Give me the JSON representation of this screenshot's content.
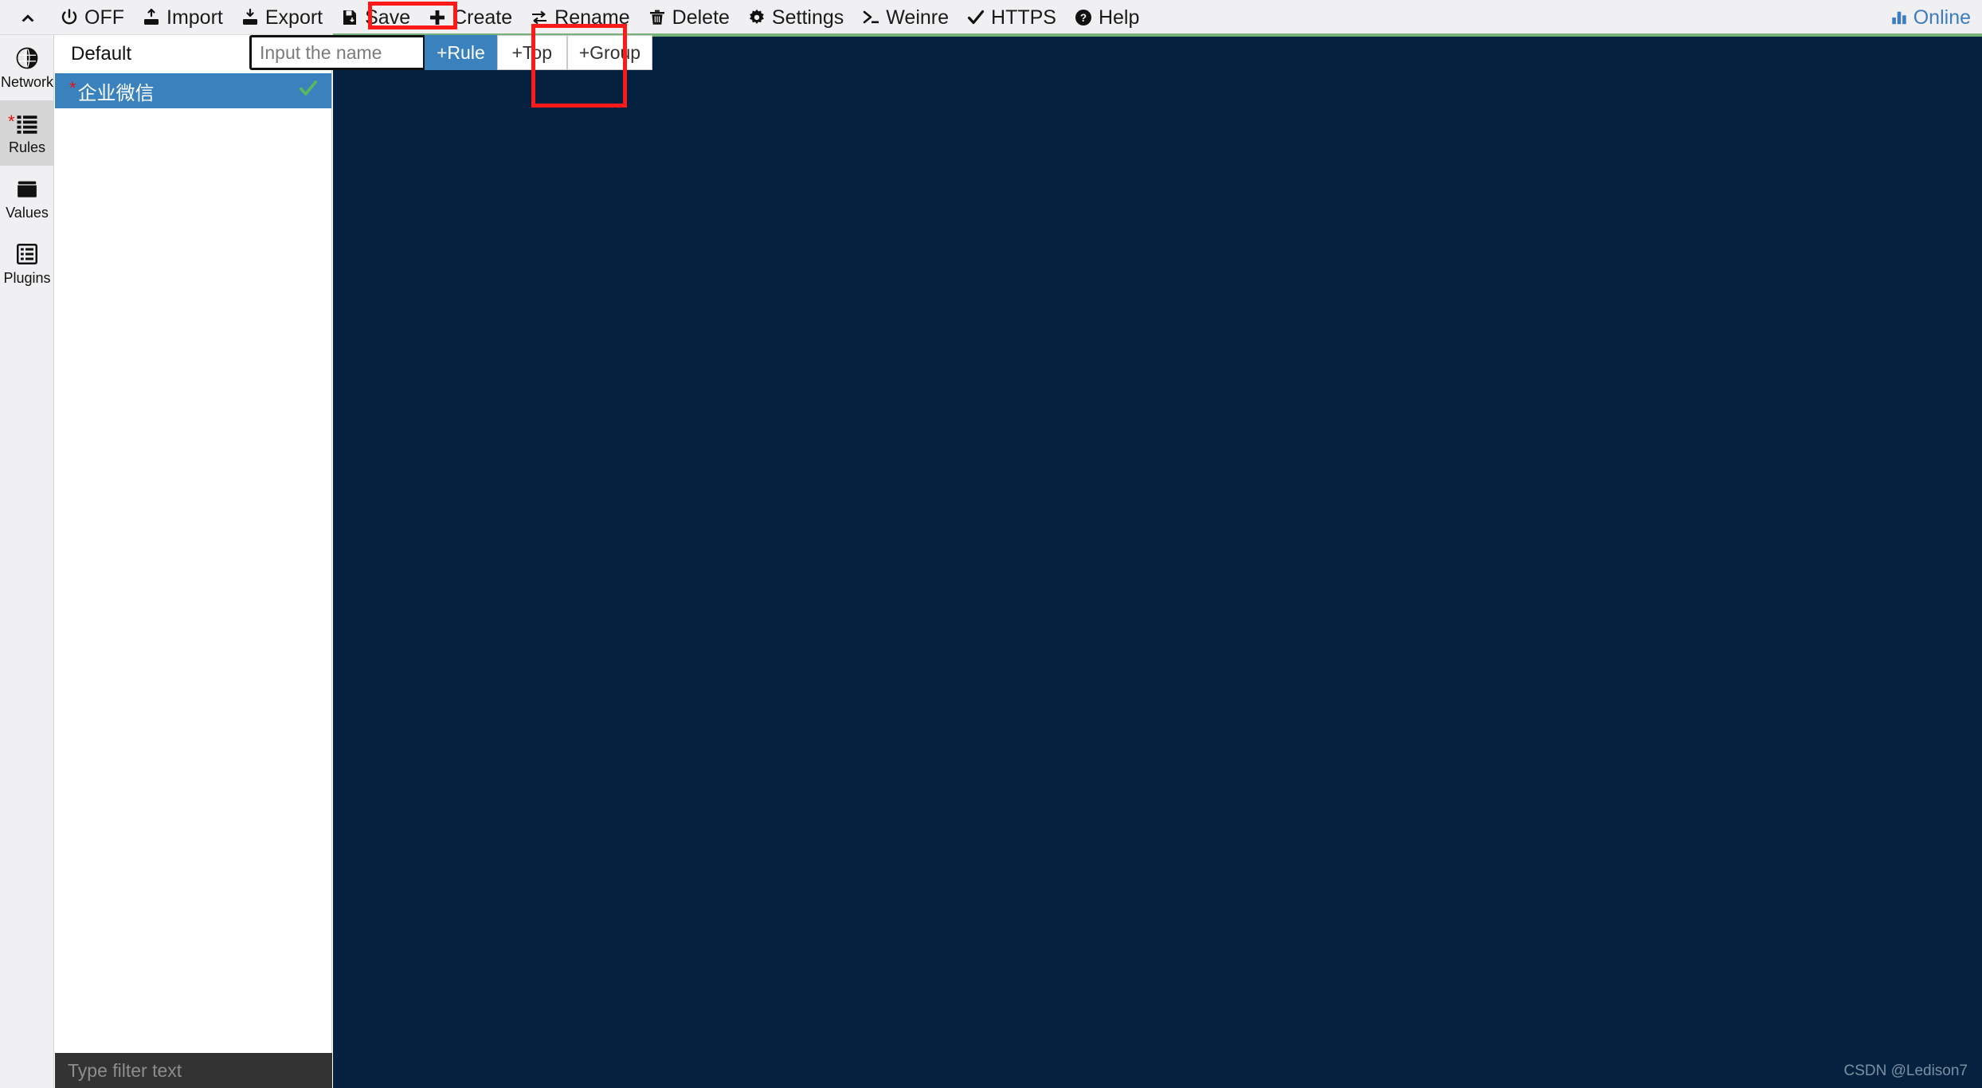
{
  "toolbar": {
    "collapse_icon": "chevron-up-icon",
    "items": [
      {
        "id": "off",
        "label": "OFF",
        "icon": "power-icon"
      },
      {
        "id": "import",
        "label": "Import",
        "icon": "import-icon"
      },
      {
        "id": "export",
        "label": "Export",
        "icon": "export-icon"
      },
      {
        "id": "save",
        "label": "Save",
        "icon": "save-icon"
      },
      {
        "id": "create",
        "label": "Create",
        "icon": "plus-icon"
      },
      {
        "id": "rename",
        "label": "Rename",
        "icon": "rename-icon"
      },
      {
        "id": "delete",
        "label": "Delete",
        "icon": "trash-icon"
      },
      {
        "id": "settings",
        "label": "Settings",
        "icon": "gear-icon"
      },
      {
        "id": "weinre",
        "label": "Weinre",
        "icon": "terminal-icon"
      },
      {
        "id": "https",
        "label": "HTTPS",
        "icon": "check-icon"
      },
      {
        "id": "help",
        "label": "Help",
        "icon": "question-circle-icon"
      }
    ],
    "status": {
      "label": "Online",
      "icon": "bar-chart-icon",
      "color": "#3c7cbf"
    }
  },
  "rail": {
    "items": [
      {
        "id": "network",
        "label": "Network",
        "icon": "globe-icon",
        "active": false,
        "modified": false
      },
      {
        "id": "rules",
        "label": "Rules",
        "icon": "list-icon",
        "active": true,
        "modified": true
      },
      {
        "id": "values",
        "label": "Values",
        "icon": "folder-icon",
        "active": false,
        "modified": false
      },
      {
        "id": "plugins",
        "label": "Plugins",
        "icon": "plugins-icon",
        "active": false,
        "modified": false
      }
    ]
  },
  "list_panel": {
    "header_label": "Default",
    "rows": [
      {
        "name": "企业微信",
        "selected": true,
        "modified": true,
        "enabled": true,
        "check_icon": "check-icon"
      }
    ],
    "filter_placeholder": "Type filter text"
  },
  "create_bar": {
    "input_value": "",
    "input_placeholder": "Input the name",
    "buttons": [
      {
        "id": "rule",
        "label": "+Rule",
        "primary": true
      },
      {
        "id": "top",
        "label": "+Top",
        "primary": false
      },
      {
        "id": "group",
        "label": "+Group",
        "primary": false
      }
    ]
  },
  "main": {
    "watermark": "CSDN @Ledison7",
    "background_color": "#04223f",
    "accent_bar_color": "#77b17a"
  },
  "annotations": {
    "highlight_color": "#ff1a1a",
    "boxes": [
      {
        "id": "create-button-highlight",
        "target": "Create"
      },
      {
        "id": "rule-button-highlight",
        "target": "+Rule"
      }
    ]
  }
}
